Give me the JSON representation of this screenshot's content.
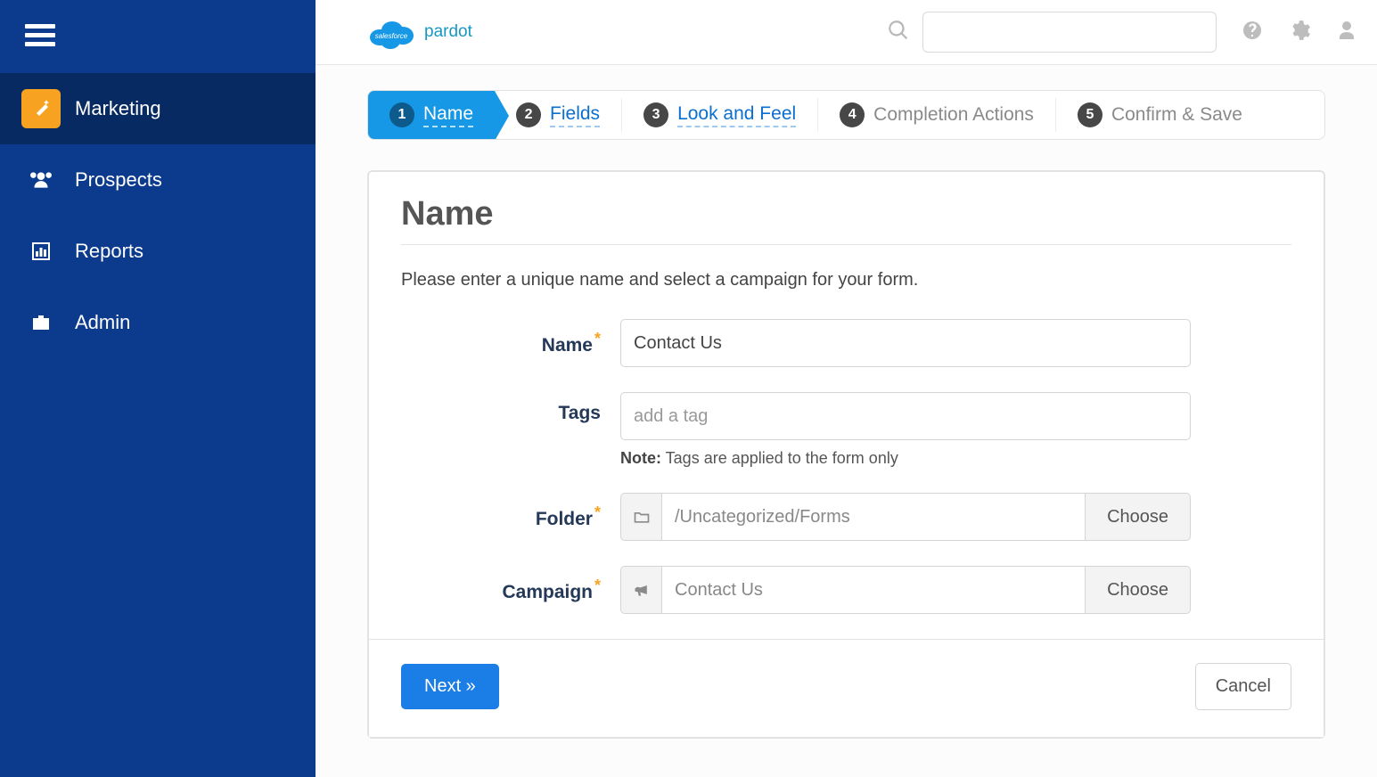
{
  "brand": {
    "product": "pardot"
  },
  "sidebar": {
    "items": [
      {
        "label": "Marketing",
        "icon": "wand-icon",
        "active": true
      },
      {
        "label": "Prospects",
        "icon": "people-icon",
        "active": false
      },
      {
        "label": "Reports",
        "icon": "chart-icon",
        "active": false
      },
      {
        "label": "Admin",
        "icon": "briefcase-icon",
        "active": false
      }
    ]
  },
  "topbar": {
    "search_placeholder": ""
  },
  "wizard": {
    "steps": [
      {
        "num": "1",
        "label": "Name",
        "active": true,
        "link": true
      },
      {
        "num": "2",
        "label": "Fields",
        "active": false,
        "link": true
      },
      {
        "num": "3",
        "label": "Look and Feel",
        "active": false,
        "link": true
      },
      {
        "num": "4",
        "label": "Completion Actions",
        "active": false,
        "link": false
      },
      {
        "num": "5",
        "label": "Confirm & Save",
        "active": false,
        "link": false
      }
    ]
  },
  "panel": {
    "title": "Name",
    "helper": "Please enter a unique name and select a campaign for your form.",
    "fields": {
      "name": {
        "label": "Name",
        "value": "Contact Us",
        "required": true
      },
      "tags": {
        "label": "Tags",
        "placeholder": "add a tag",
        "note_prefix": "Note:",
        "note_text": " Tags are applied to the form only",
        "required": false
      },
      "folder": {
        "label": "Folder",
        "value": "/Uncategorized/Forms",
        "choose": "Choose",
        "required": true
      },
      "campaign": {
        "label": "Campaign",
        "value": "Contact Us",
        "choose": "Choose",
        "required": true
      }
    },
    "actions": {
      "next": "Next »",
      "cancel": "Cancel"
    }
  }
}
